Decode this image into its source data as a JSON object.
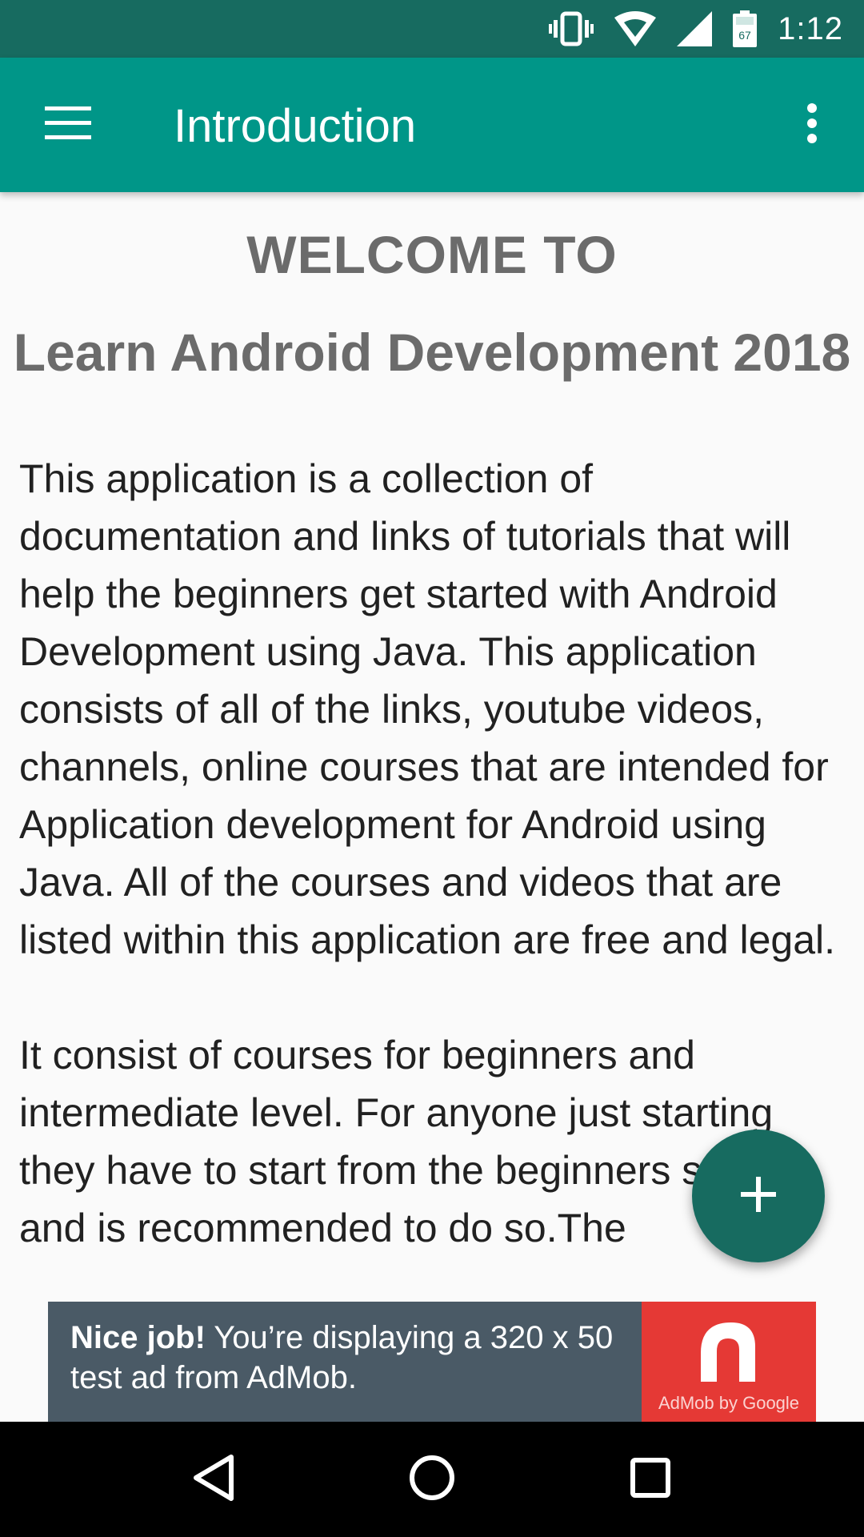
{
  "status_bar": {
    "time": "1:12",
    "battery_level": "67",
    "icons": [
      "vibrate-icon",
      "wifi-icon",
      "signal-icon",
      "battery-icon"
    ]
  },
  "app_bar": {
    "title": "Introduction",
    "menu_icon": "hamburger-menu-icon",
    "overflow_icon": "more-vert-icon",
    "color": "#009688"
  },
  "content": {
    "welcome": "WELCOME TO",
    "app_name": "Learn Android Development 2018",
    "paragraphs": [
      "This application is a collection of documentation and links of tutorials that will help the beginners get started with Android Development using Java. This application consists of all of the links, youtube videos, channels, online courses that are intended for Application development for Android using Java. All of the courses and videos that are listed within this application are free and legal.",
      "It consist of courses for beginners and intermediate level. For anyone just starting they have to start from the beginners section and is recommended to do so.The"
    ]
  },
  "fab": {
    "icon": "add-icon",
    "color": "#176B60"
  },
  "ad_banner": {
    "headline": "Nice job!",
    "message": "You’re displaying a 320 x 50 test ad from AdMob.",
    "brand": "AdMob by Google"
  },
  "nav_bar": {
    "icons": [
      "back-icon",
      "home-icon",
      "recents-icon"
    ]
  }
}
